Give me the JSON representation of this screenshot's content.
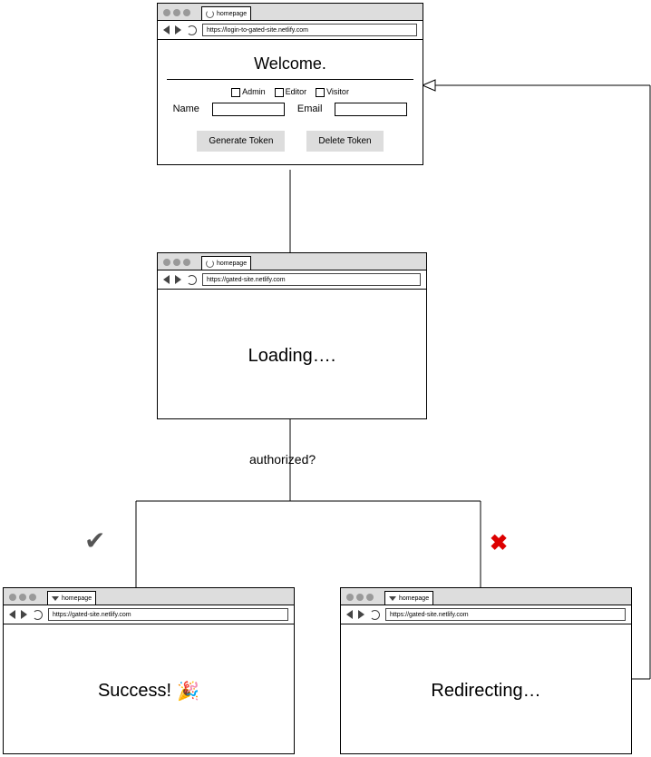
{
  "decision_label": "authorized?",
  "success_mark": "✔",
  "fail_mark": "✖",
  "party": "🎉",
  "windows": {
    "login": {
      "tab": "homepage",
      "url": "https://login-to-gated-site.netlify.com",
      "title": "Welcome.",
      "roles": [
        "Admin",
        "Editor",
        "Visitor"
      ],
      "name_label": "Name",
      "email_label": "Email",
      "generate_btn": "Generate Token",
      "delete_btn": "Delete Token"
    },
    "loading": {
      "tab": "homepage",
      "url": "https://gated-site.netlify.com",
      "text": "Loading…."
    },
    "success": {
      "tab": "homepage",
      "url": "https://gated-site.netlify.com",
      "text": "Success!"
    },
    "redirect": {
      "tab": "homepage",
      "url": "https://gated-site.netlify.com",
      "text": "Redirecting…"
    }
  }
}
